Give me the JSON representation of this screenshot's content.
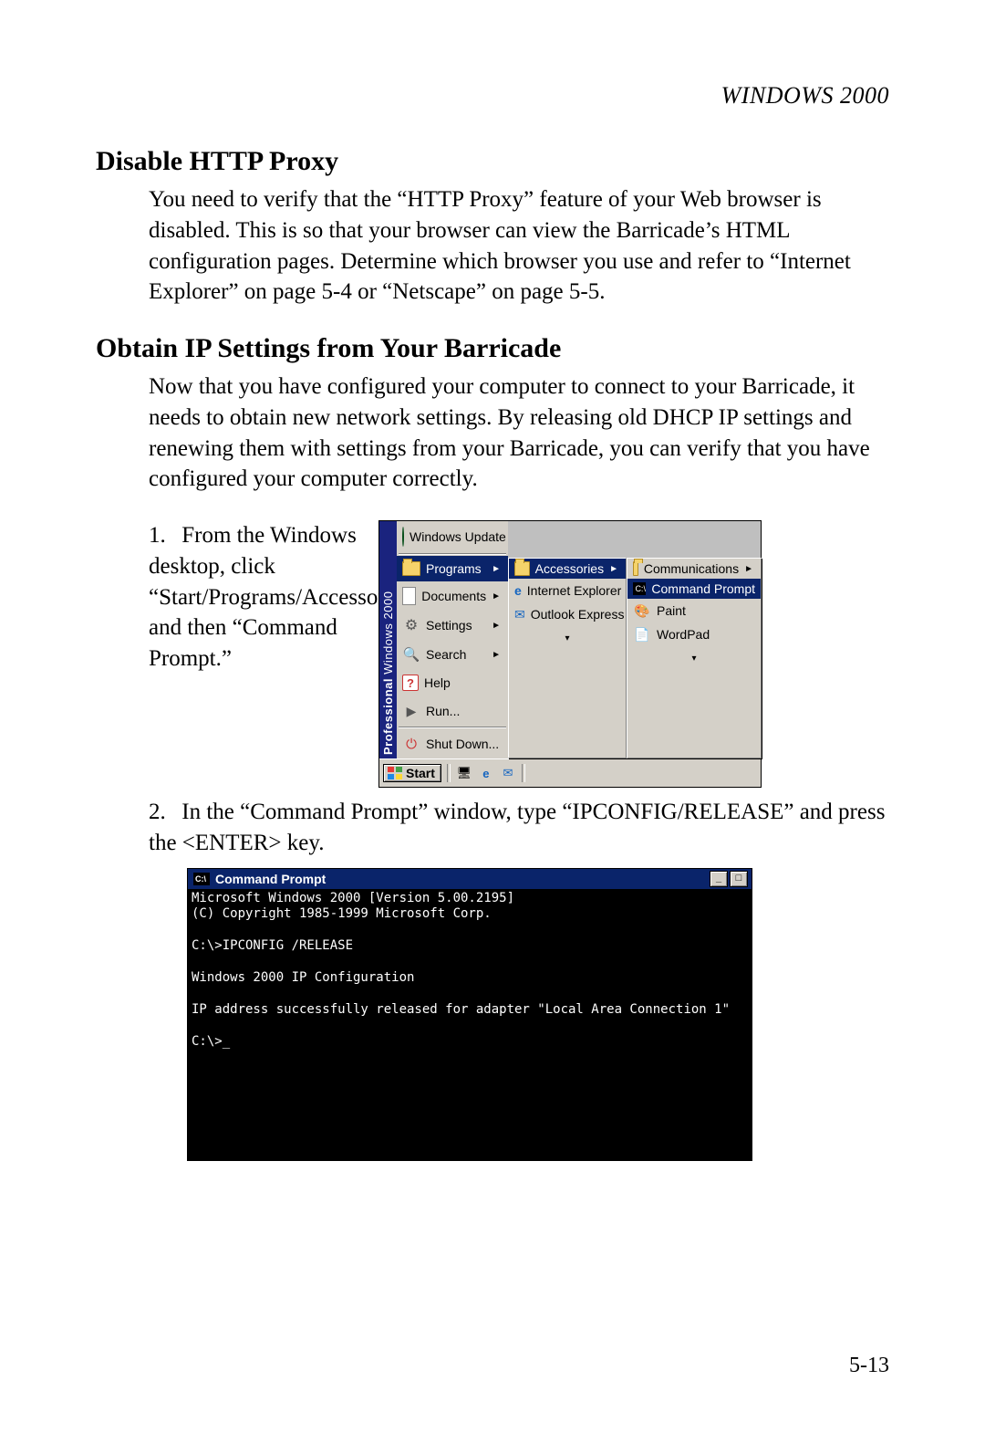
{
  "running_head": "WINDOWS 2000",
  "page_number": "5-13",
  "section1": {
    "heading": "Disable HTTP Proxy",
    "body": "You need to verify that the “HTTP Proxy” feature of your Web browser is disabled. This is so that your browser can view the Barricade’s HTML configuration pages. Determine which browser you use and refer to “Internet Explorer” on page 5-4 or “Netscape” on page 5-5."
  },
  "section2": {
    "heading": "Obtain IP Settings from Your Barricade",
    "body": "Now that you have configured your computer to connect to your Barricade, it needs to obtain new network settings. By releasing old DHCP IP settings and renewing them with settings from your Barricade, you can verify that you have configured your computer correctly.",
    "steps": [
      {
        "num": "1.",
        "text": "From the Windows desktop, click “Start/Programs/Accessories,” and then “Command Prompt.”"
      },
      {
        "num": "2.",
        "text": "In the “Command Prompt” window, type “IPCONFIG/RELEASE” and press the <ENTER> key."
      }
    ]
  },
  "start_menu": {
    "branding_line1": "Professional",
    "branding_line2": "Windows 2000",
    "items": [
      {
        "icon": "globe-icon",
        "label": "Windows Update"
      },
      {
        "icon": "folder-icon",
        "label": "Programs",
        "submenu": true
      },
      {
        "icon": "doc-icon",
        "label": "Documents",
        "submenu": true
      },
      {
        "icon": "gear-icon",
        "label": "Settings",
        "submenu": true
      },
      {
        "icon": "magnifier-icon",
        "label": "Search",
        "submenu": true
      },
      {
        "icon": "help-icon",
        "label": "Help"
      },
      {
        "icon": "run-icon",
        "label": "Run..."
      },
      {
        "icon": "shutdown-icon",
        "label": "Shut Down..."
      }
    ],
    "programs_submenu": [
      {
        "icon": "folder-icon",
        "label": "Accessories",
        "submenu": true,
        "highlighted": true
      },
      {
        "icon": "ie-icon",
        "label": "Internet Explorer"
      },
      {
        "icon": "envelope-icon",
        "label": "Outlook Express"
      },
      {
        "icon": "chevron-down-icon",
        "label": ""
      }
    ],
    "accessories_submenu": [
      {
        "icon": "folder-icon",
        "label": "Communications",
        "submenu": true
      },
      {
        "icon": "cmd-icon",
        "label": "Command Prompt",
        "highlighted": true
      },
      {
        "icon": "paint-icon",
        "label": "Paint"
      },
      {
        "icon": "wordpad-icon",
        "label": "WordPad"
      },
      {
        "icon": "chevron-down-icon",
        "label": ""
      }
    ],
    "taskbar": {
      "start": "Start",
      "tray_icons": [
        "desktop-icon",
        "ie-icon",
        "outlook-icon"
      ]
    }
  },
  "cmd_window": {
    "title": "Command Prompt",
    "lines": [
      "Microsoft Windows 2000 [Version 5.00.2195]",
      "(C) Copyright 1985-1999 Microsoft Corp.",
      "",
      "C:\\>IPCONFIG /RELEASE",
      "",
      "Windows 2000 IP Configuration",
      "",
      "IP address successfully released for adapter \"Local Area Connection 1\"",
      "",
      "C:\\>_"
    ]
  }
}
